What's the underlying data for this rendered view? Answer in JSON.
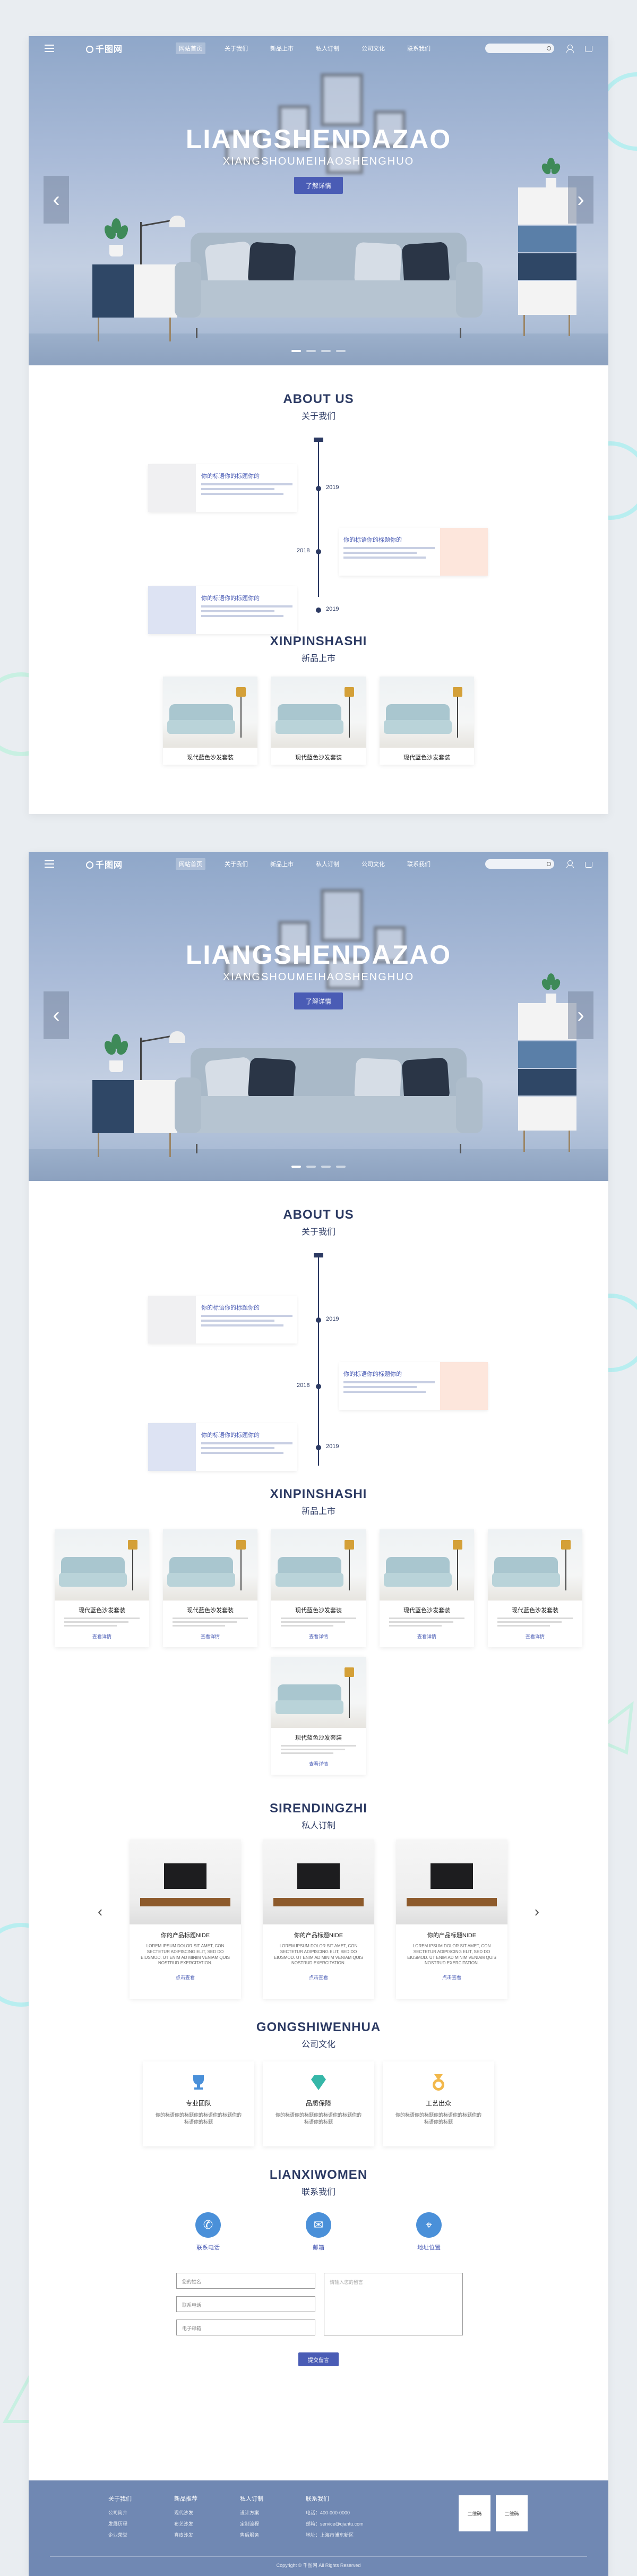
{
  "nav": {
    "logo": "千图网",
    "links": [
      "网站首页",
      "关于我们",
      "新品上市",
      "私人订制",
      "公司文化",
      "联系我们"
    ],
    "active_index": 0
  },
  "hero": {
    "title": "LIANGSHENDAZAO",
    "subtitle": "XIANGSHOUMEIHAOSHENGHUO",
    "button": "了解详情",
    "slides": 4,
    "active_slide": 0
  },
  "about": {
    "title": "ABOUT US",
    "subtitle": "关于我们",
    "items": [
      {
        "title": "你的标语你的标题你的",
        "year": "2019"
      },
      {
        "title": "你的标语你的标题你的",
        "year": "2018"
      },
      {
        "title": "你的标语你的标题你的",
        "year": "2019"
      }
    ]
  },
  "products": {
    "title": "XINPINSHASHI",
    "subtitle": "新品上市",
    "name": "现代蓝色沙发套装",
    "more": "查看详情"
  },
  "custom": {
    "title": "SIRENDINGZHI",
    "subtitle": "私人订制",
    "name": "你的产品标题NIDE",
    "desc": "LOREM IPSUM DOLOR SIT AMET, CON SECTETUR ADIPISCING ELIT, SED DO EIUSMOD. UT ENIM AD MINIM VENIAM QUIS NOSTRUD EXERCITATION.",
    "more": "点击查看"
  },
  "culture": {
    "title": "GONGSHIWENHUA",
    "subtitle": "公司文化",
    "items": [
      {
        "name": "专业团队",
        "desc": "你的标语你的标题你的标语你的标题你的标语你的标题"
      },
      {
        "name": "品质保障",
        "desc": "你的标语你的标题你的标语你的标题你的标语你的标题"
      },
      {
        "name": "工艺出众",
        "desc": "你的标语你的标题你的标语你的标题你的标语你的标题"
      }
    ]
  },
  "contact": {
    "title": "LIANXIWOMEN",
    "subtitle": "联系我们",
    "items": [
      "联系电话",
      "邮箱",
      "地址位置"
    ],
    "form": {
      "name_placeholder": "您的姓名",
      "phone_placeholder": "联系电话",
      "email_placeholder": "电子邮箱",
      "message_placeholder": "请输入您的留言",
      "submit": "提交留言"
    }
  },
  "footer": {
    "columns": [
      {
        "title": "关于我们",
        "links": [
          "公司简介",
          "发展历程",
          "企业荣誉"
        ]
      },
      {
        "title": "新品推荐",
        "links": [
          "现代沙发",
          "布艺沙发",
          "真皮沙发"
        ]
      },
      {
        "title": "私人订制",
        "links": [
          "设计方案",
          "定制流程",
          "售后服务"
        ]
      },
      {
        "title": "联系我们",
        "links": [
          "电话：400-000-0000",
          "邮箱：service@qiantu.com",
          "地址：上海市浦东新区"
        ]
      }
    ],
    "qr_labels": [
      "二维码",
      "二维码"
    ],
    "copyright": "Copyright © 千图网 All Rights Reserved"
  },
  "colors": {
    "accent": "#4a5cb5",
    "navy": "#2c3a63",
    "footer": "#7088b3"
  }
}
